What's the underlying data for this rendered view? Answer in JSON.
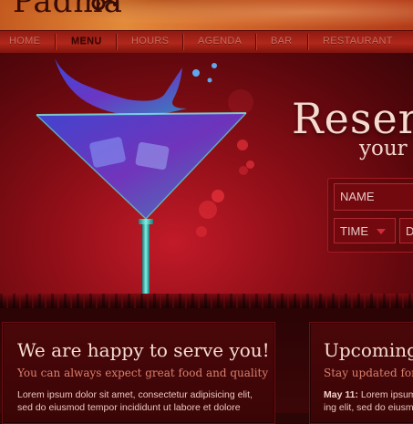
{
  "brand": {
    "logo_text": "Padma",
    "colors": {
      "accent": "#b1271b",
      "deep": "#5a070c",
      "cream": "#f6d9cf",
      "muted": "#d9806e"
    }
  },
  "nav": {
    "items": [
      {
        "label": "HOME",
        "active": false
      },
      {
        "label": "MENU",
        "active": true
      },
      {
        "label": "HOURS",
        "active": false
      },
      {
        "label": "AGENDA",
        "active": false
      },
      {
        "label": "BAR",
        "active": false
      },
      {
        "label": "RESTAURANT",
        "active": false
      }
    ]
  },
  "hero": {
    "title": "Reser",
    "subtitle": "your",
    "form": {
      "name_placeholder": "NAME",
      "time_label": "TIME",
      "date_label": "D"
    }
  },
  "sections": {
    "welcome": {
      "title": "We are happy to serve you!",
      "subtitle": "You can always expect great food and quality",
      "body_line1": "Lorem ipsum dolor sit amet, consectetur adipisicing elit,",
      "body_line2": "sed do eiusmod tempor incididunt ut labore et dolore"
    },
    "upcoming": {
      "title": "Upcoming",
      "subtitle": "Stay updated for g",
      "date": "May 11:",
      "body_line1": " Lorem ipsum",
      "body_line2": "ing elit, sed do eiusmo"
    }
  }
}
